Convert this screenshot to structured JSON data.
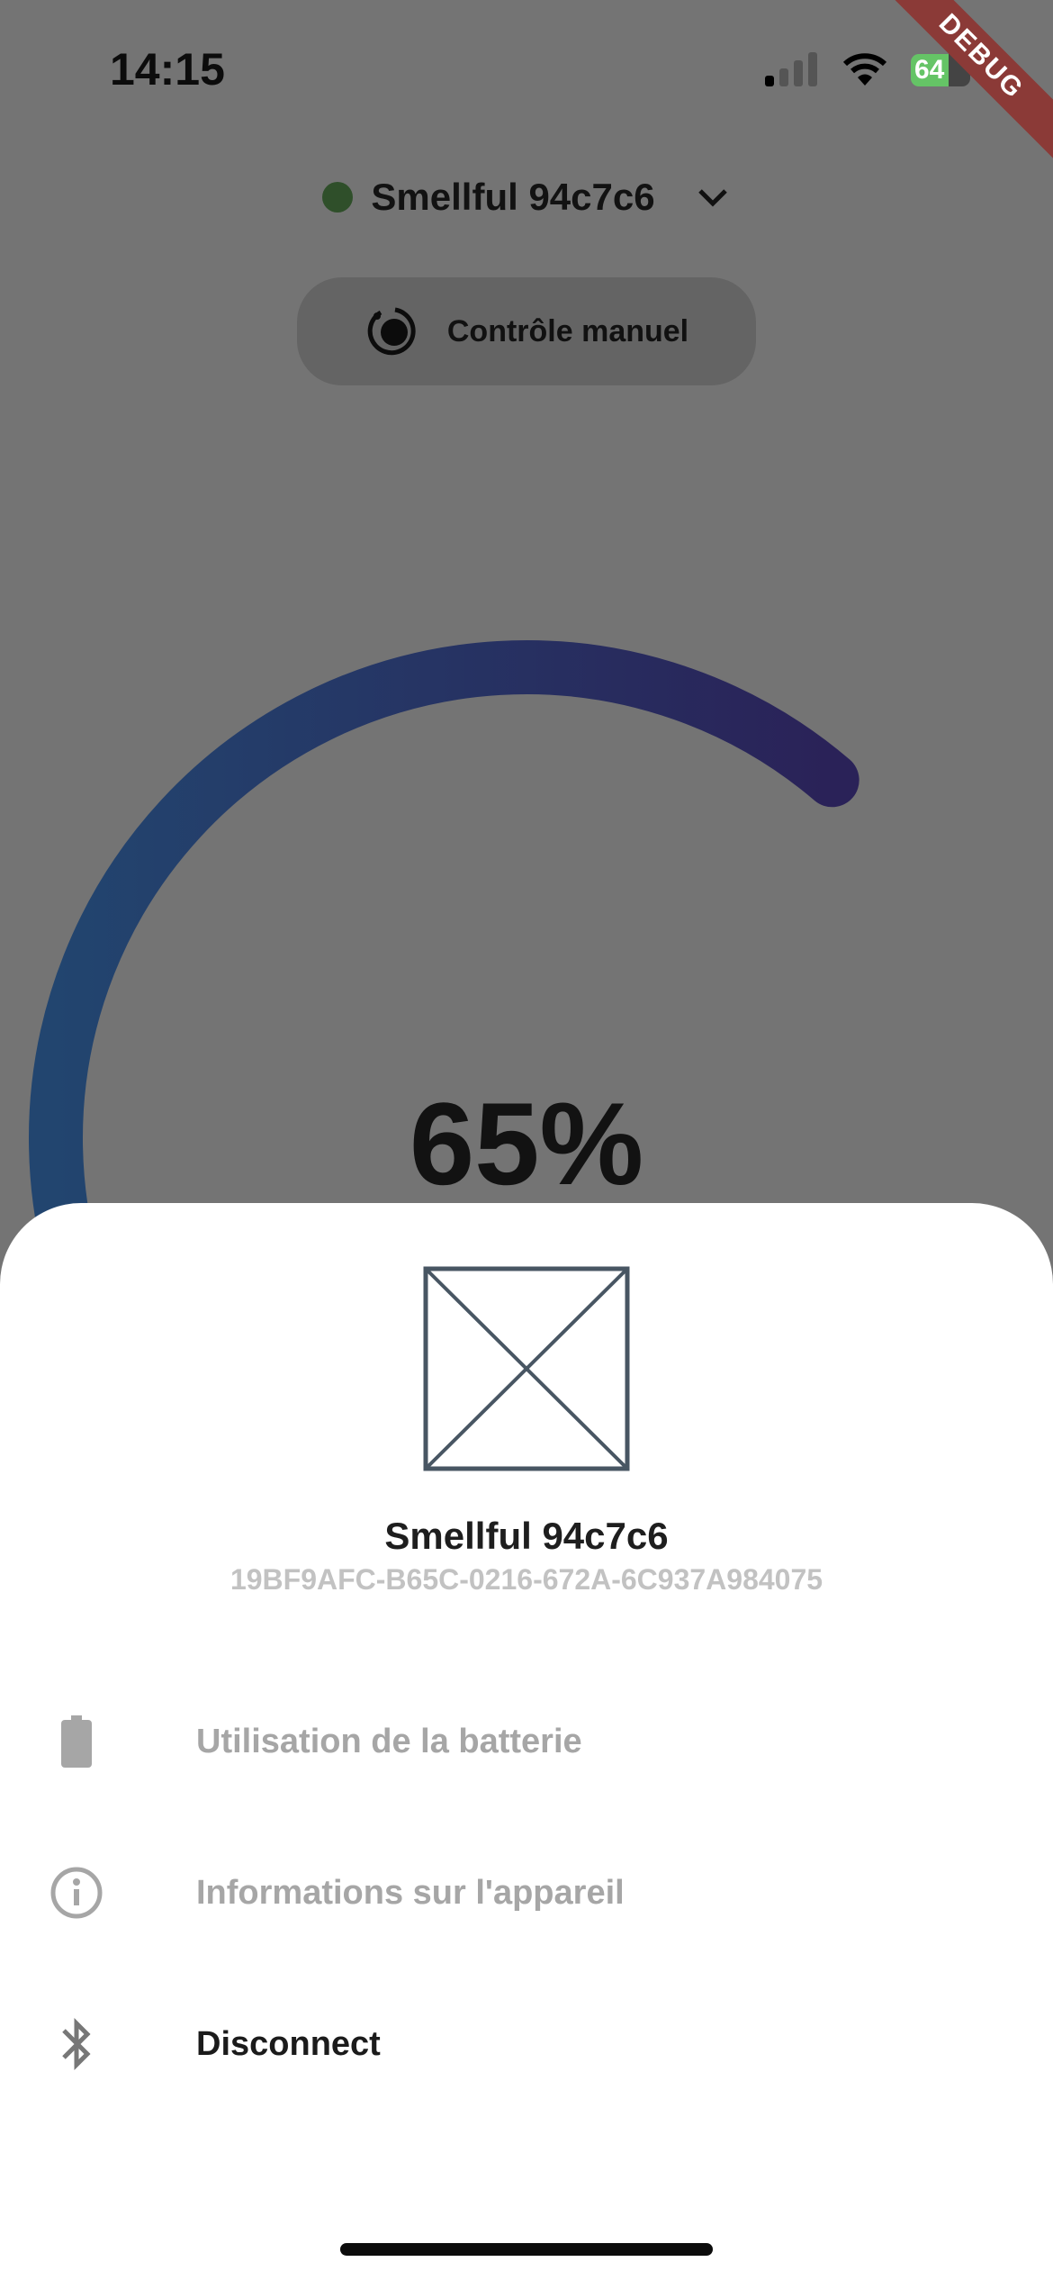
{
  "status_bar": {
    "time": "14:15",
    "battery": "64",
    "debug_banner": "DEBUG"
  },
  "header": {
    "device_name": "Smellful 94c7c6",
    "status_color": "#2f4f2a",
    "manual_button": "Contrôle manuel"
  },
  "gauge": {
    "value_label": "65%",
    "value_percent": 65,
    "gradient": [
      "#22456f",
      "#2a2258"
    ]
  },
  "sheet": {
    "device_name": "Smellful 94c7c6",
    "device_id": "19BF9AFC-B65C-0216-672A-6C937A984075",
    "items": [
      {
        "icon": "battery-icon",
        "label": "Utilisation de la batterie",
        "enabled": false
      },
      {
        "icon": "info-icon",
        "label": "Informations sur l'appareil",
        "enabled": false
      },
      {
        "icon": "bluetooth-icon",
        "label": "Disconnect",
        "enabled": true
      }
    ]
  }
}
